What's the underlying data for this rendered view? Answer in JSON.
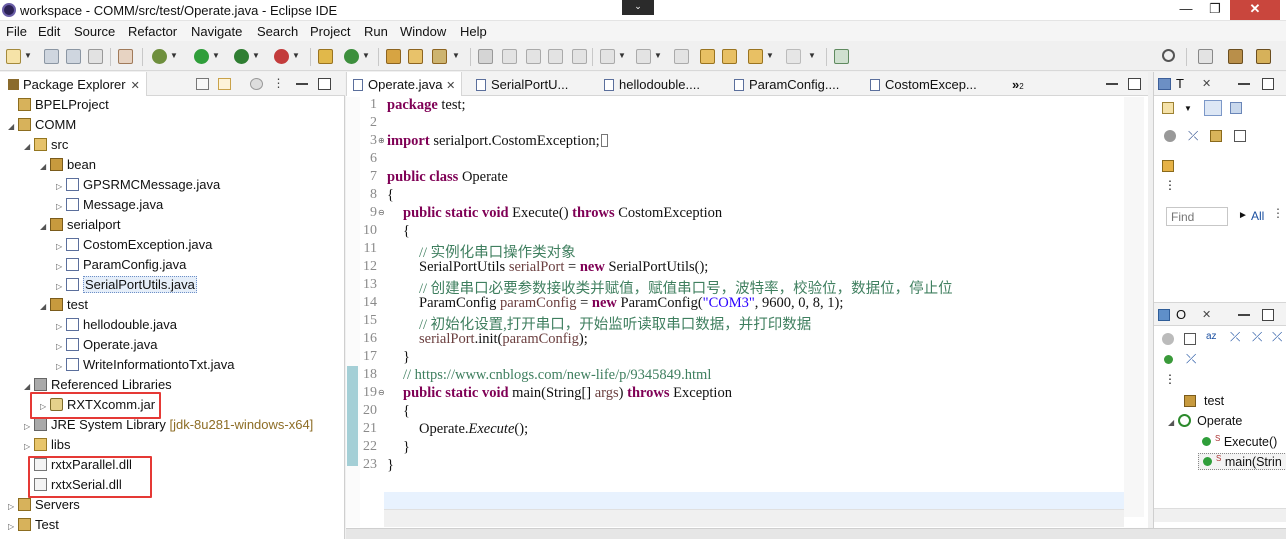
{
  "window": {
    "title": "workspace - COMM/src/test/Operate.java - Eclipse IDE",
    "minimize": "—",
    "maximize": "❐",
    "close": "✕"
  },
  "menu": [
    "File",
    "Edit",
    "Source",
    "Refactor",
    "Navigate",
    "Search",
    "Project",
    "Run",
    "Window",
    "Help"
  ],
  "package_explorer": {
    "title": "Package Explorer",
    "close": "✕",
    "tree": [
      {
        "label": "BPELProject",
        "icon": "project-icon",
        "expanded": false
      },
      {
        "label": "COMM",
        "icon": "project-icon",
        "expanded": true
      },
      {
        "label": "src",
        "icon": "source-folder-icon",
        "expanded": true
      },
      {
        "label": "bean",
        "icon": "package-icon",
        "expanded": true
      },
      {
        "label": "GPSRMCMessage.java",
        "icon": "java-file-icon"
      },
      {
        "label": "Message.java",
        "icon": "java-file-icon"
      },
      {
        "label": "serialport",
        "icon": "package-icon",
        "expanded": true
      },
      {
        "label": "CostomException.java",
        "icon": "java-file-icon"
      },
      {
        "label": "ParamConfig.java",
        "icon": "java-file-icon"
      },
      {
        "label": "SerialPortUtils.java",
        "icon": "java-file-icon",
        "selected": true
      },
      {
        "label": "test",
        "icon": "package-icon",
        "expanded": true
      },
      {
        "label": "hellodouble.java",
        "icon": "java-file-icon"
      },
      {
        "label": "Operate.java",
        "icon": "java-file-icon"
      },
      {
        "label": "WriteInformationtoTxt.java",
        "icon": "java-file-icon"
      },
      {
        "label": "Referenced Libraries",
        "icon": "library-icon",
        "expanded": true
      },
      {
        "label": "RXTXcomm.jar",
        "icon": "jar-icon"
      },
      {
        "label": "JRE System Library",
        "suffix": "[jdk-8u281-windows-x64]",
        "icon": "library-icon"
      },
      {
        "label": "libs",
        "icon": "folder-icon"
      },
      {
        "label": "rxtxParallel.dll",
        "icon": "file-icon"
      },
      {
        "label": "rxtxSerial.dll",
        "icon": "file-icon"
      },
      {
        "label": "Servers",
        "icon": "project-icon"
      },
      {
        "label": "Test",
        "icon": "project-icon"
      }
    ]
  },
  "editor": {
    "tabs": [
      {
        "label": "Operate.java",
        "active": true,
        "close": "✕"
      },
      {
        "label": "SerialPortU..."
      },
      {
        "label": "hellodouble...."
      },
      {
        "label": "ParamConfig...."
      },
      {
        "label": "CostomExcep..."
      }
    ],
    "overflow": "»",
    "overflow_count": "2",
    "line_numbers": [
      "1",
      "2",
      "3",
      "6",
      "7",
      "8",
      "9",
      "10",
      "11",
      "12",
      "13",
      "14",
      "15",
      "16",
      "17",
      "18",
      "19",
      "20",
      "21",
      "22",
      "23"
    ],
    "code": {
      "l1_kw": "package",
      "l1_rest": " test;",
      "l3_kw": "import",
      "l3_rest": " serialport.CostomException;",
      "l7_kw": "public class",
      "l7_rest": " Operate",
      "l8": "{",
      "l9_kw1": "public static void",
      "l9_mid": " Execute() ",
      "l9_kw2": "throws",
      "l9_rest": " CostomException",
      "l10": "{",
      "l11": "// 实例化串口操作类对象",
      "l12_a": "SerialPortUtils ",
      "l12_var": "serialPort",
      "l12_b": " = ",
      "l12_kw": "new",
      "l12_c": " SerialPortUtils();",
      "l13": "// 创建串口必要参数接收类并赋值，赋值串口号，波特率，校验位，数据位，停止位",
      "l14_a": "ParamConfig ",
      "l14_var": "paramConfig",
      "l14_b": " = ",
      "l14_kw": "new",
      "l14_c": " ParamConfig(",
      "l14_str": "\"COM3\"",
      "l14_d": ", 9600, 0, 8, 1);",
      "l15": "// 初始化设置,打开串口，开始监听读取串口数据，并打印数据",
      "l16_var": "serialPort",
      "l16_rest": ".init(",
      "l16_var2": "paramConfig",
      "l16_end": ");",
      "l17": "}",
      "l18": "// https://www.cnblogs.com/new-life/p/9345849.html",
      "l19_kw1": "public static void",
      "l19_mid": " main(String[] ",
      "l19_var": "args",
      "l19_mid2": ") ",
      "l19_kw2": "throws",
      "l19_rest": " Exception",
      "l20": "{",
      "l21_a": "Operate.",
      "l21_ital": "Execute",
      "l21_b": "();",
      "l22": "}",
      "l23": "}"
    }
  },
  "task_list": {
    "tab": "T",
    "close": "✕",
    "find_placeholder": "Find",
    "all_label": "All"
  },
  "outline": {
    "tab": "O",
    "close": "✕",
    "items": [
      {
        "label": "test",
        "icon": "package-icon"
      },
      {
        "label": "Operate",
        "icon": "class-icon"
      },
      {
        "label": "Execute()",
        "icon": "method-icon"
      },
      {
        "label": "main(Strin",
        "icon": "method-icon"
      }
    ]
  },
  "colors": {
    "keyword": "#7f0055",
    "comment": "#3f7f5f",
    "string": "#2a00ff",
    "highlight_box": "#e53935"
  }
}
